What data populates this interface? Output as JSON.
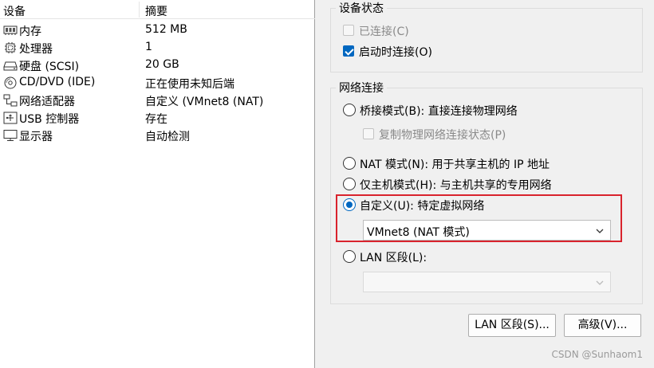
{
  "device_list": {
    "headers": {
      "device": "设备",
      "summary": "摘要"
    },
    "rows": [
      {
        "icon": "memory-icon",
        "name": "内存",
        "summary": "512 MB"
      },
      {
        "icon": "processor-icon",
        "name": "处理器",
        "summary": "1"
      },
      {
        "icon": "hard-disk-icon",
        "name": "硬盘 (SCSI)",
        "summary": "20 GB"
      },
      {
        "icon": "cd-dvd-icon",
        "name": "CD/DVD (IDE)",
        "summary": "正在使用未知后端"
      },
      {
        "icon": "network-adapter-icon",
        "name": "网络适配器",
        "summary": "自定义 (VMnet8 (NAT)"
      },
      {
        "icon": "usb-icon",
        "name": "USB 控制器",
        "summary": "存在"
      },
      {
        "icon": "display-icon",
        "name": "显示器",
        "summary": "自动检测"
      }
    ]
  },
  "device_status": {
    "title": "设备状态",
    "connected": {
      "label": "已连接(C)",
      "checked": false,
      "disabled": true
    },
    "connect_at_power_on": {
      "label": "启动时连接(O)",
      "checked": true
    }
  },
  "network_connection": {
    "title": "网络连接",
    "bridged": {
      "label": "桥接模式(B): 直接连接物理网络",
      "selected": false
    },
    "replicate_state": {
      "label": "复制物理网络连接状态(P)",
      "checked": false,
      "disabled": true
    },
    "nat": {
      "label": "NAT 模式(N): 用于共享主机的 IP 地址",
      "selected": false
    },
    "host_only": {
      "label": "仅主机模式(H): 与主机共享的专用网络",
      "selected": false
    },
    "custom": {
      "label": "自定义(U): 特定虚拟网络",
      "selected": true
    },
    "custom_select_value": "VMnet8 (NAT 模式)",
    "lan_segment": {
      "label": "LAN 区段(L):",
      "selected": false
    },
    "lan_select_value": ""
  },
  "buttons": {
    "lan_segments": "LAN 区段(S)...",
    "advanced": "高级(V)..."
  },
  "watermark": "CSDN @Sunhaom1",
  "colors": {
    "accent": "#0067c0",
    "highlight": "#d9232d"
  }
}
